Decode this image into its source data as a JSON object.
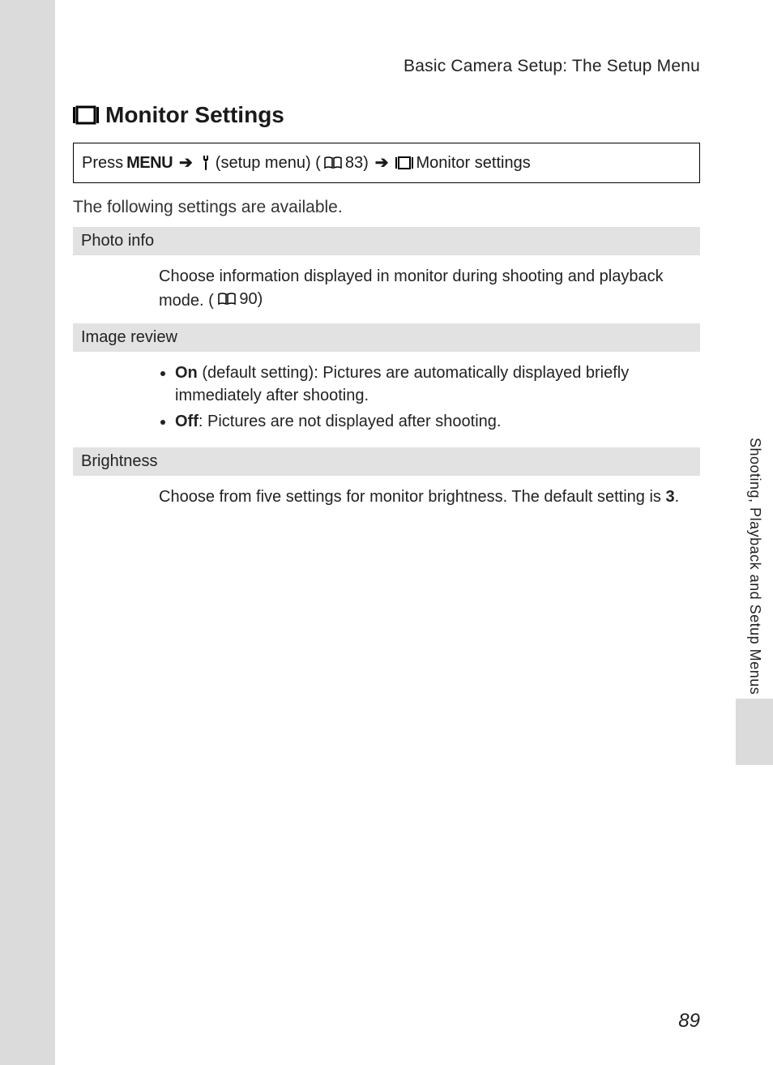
{
  "section_header": "Basic Camera Setup: The Setup Menu",
  "heading": "Monitor Settings",
  "nav": {
    "press": "Press",
    "menu": "MENU",
    "setup_menu": "(setup menu) (",
    "ref1": "83)",
    "monitor_settings": "Monitor settings"
  },
  "intro": "The following settings are available.",
  "rows": [
    {
      "label": "Photo info",
      "body_text": "Choose information displayed in monitor during shooting and playback mode. (",
      "body_ref": "90)"
    },
    {
      "label": "Image review",
      "items": [
        {
          "bold": "On",
          "rest": " (default setting): Pictures are automatically displayed briefly immediately after shooting."
        },
        {
          "bold": "Off",
          "rest": ": Pictures are not displayed after shooting."
        }
      ]
    },
    {
      "label": "Brightness",
      "body_text_pre": "Choose from five settings for monitor brightness. The default setting is ",
      "body_bold": "3",
      "body_text_post": "."
    }
  ],
  "side_label": "Shooting, Playback and Setup Menus",
  "page_number": "89"
}
